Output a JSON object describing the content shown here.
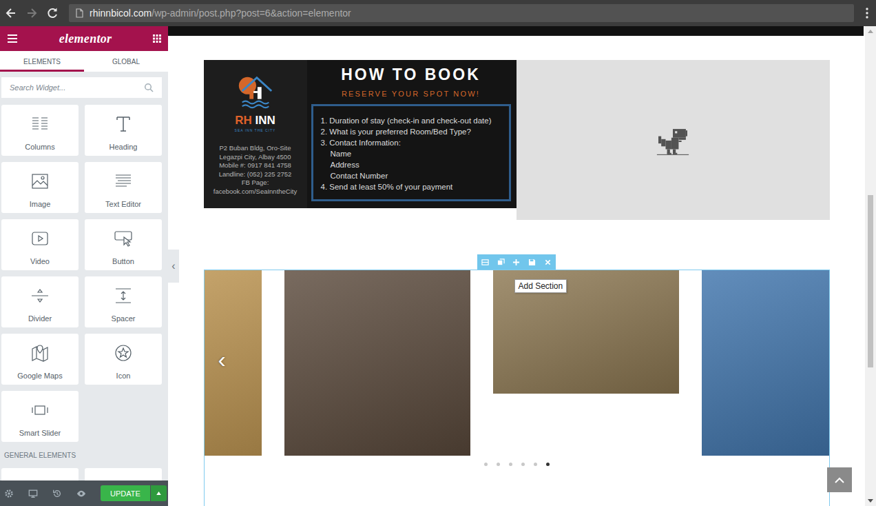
{
  "browser": {
    "url_host": "rhinnbicol.com",
    "url_path": "/wp-admin/post.php?post=6&action=elementor"
  },
  "panel": {
    "logo": "elementor",
    "tabs": [
      {
        "label": "ELEMENTS",
        "selected": true
      },
      {
        "label": "GLOBAL",
        "selected": false
      }
    ],
    "search": {
      "placeholder": "Search Widget..."
    },
    "widgets": [
      {
        "label": "Columns"
      },
      {
        "label": "Heading"
      },
      {
        "label": "Image"
      },
      {
        "label": "Text Editor"
      },
      {
        "label": "Video"
      },
      {
        "label": "Button"
      },
      {
        "label": "Divider"
      },
      {
        "label": "Spacer"
      },
      {
        "label": "Google Maps"
      },
      {
        "label": "Icon"
      },
      {
        "label": "Smart Slider"
      }
    ],
    "category": "GENERAL ELEMENTS",
    "update_button": "UPDATE"
  },
  "collapse_handle": "‹",
  "booking_flyer": {
    "brand_primary": "RH",
    "brand_secondary": "INN",
    "tagline": "SEA INN THE CITY",
    "contact": [
      "P2 Buban Bldg, Oro-Site",
      "Legazpi City, Albay 4500",
      "Mobile #: 0917 841 4758",
      "Landline: (052) 225 2752",
      "FB Page:",
      "facebook.com/SeaInntheCity"
    ],
    "title": "HOW TO BOOK",
    "subtitle": "RESERVE YOUR SPOT NOW!",
    "steps": [
      {
        "text": "1. Duration of stay (check-in and check-out date)",
        "kind": "step"
      },
      {
        "text": "2. What is your preferred Room/Bed Type?",
        "kind": "step"
      },
      {
        "text": "3. Contact Information:",
        "kind": "step"
      },
      {
        "text": "Name",
        "kind": "sub"
      },
      {
        "text": "Address",
        "kind": "sub"
      },
      {
        "text": "Contact Number",
        "kind": "sub"
      },
      {
        "text": "4. Send at least 50% of your payment",
        "kind": "step"
      }
    ]
  },
  "section_toolbar": {
    "tooltip": "Add Section"
  },
  "carousel": {
    "prev_arrow": "‹",
    "slides": [
      {
        "kind": "square",
        "color": "#c39a55"
      },
      {
        "kind": "square",
        "color": "#5b4a3c"
      },
      {
        "kind": "landscape",
        "color": "#8d7852"
      },
      {
        "kind": "square",
        "color": "#3f74ac"
      }
    ],
    "dots": [
      {
        "selected": false
      },
      {
        "selected": false
      },
      {
        "selected": false
      },
      {
        "selected": false
      },
      {
        "selected": false
      },
      {
        "selected": true
      }
    ]
  }
}
